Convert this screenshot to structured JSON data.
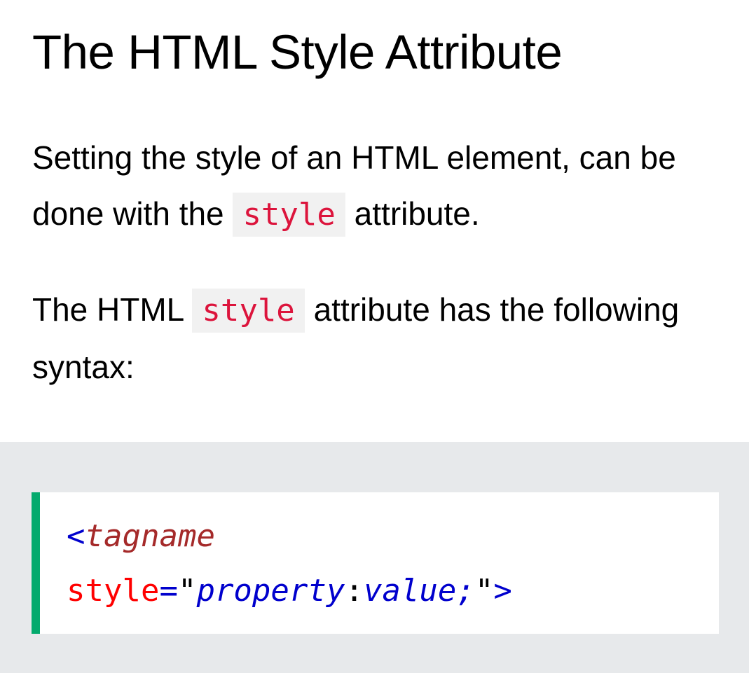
{
  "page": {
    "title": "The HTML Style Attribute"
  },
  "paragraph1": {
    "before": "Setting the style of an HTML element, can be done with the",
    "code": "style",
    "after": "attribute."
  },
  "paragraph2": {
    "before": "The HTML",
    "code": "style",
    "after": "attribute has the following syntax:"
  },
  "code_example": {
    "open_bracket": "<",
    "tagname": "tagname",
    "attr_name": "style",
    "equals": "=",
    "quote_open": "\"",
    "property": "property",
    "colon": ":",
    "value": "value;",
    "quote_close": "\"",
    "close_bracket": ">"
  },
  "colors": {
    "accent_border": "#04aa6d",
    "inline_code_text": "#dc143c",
    "code_section_bg": "#e7e9eb"
  }
}
